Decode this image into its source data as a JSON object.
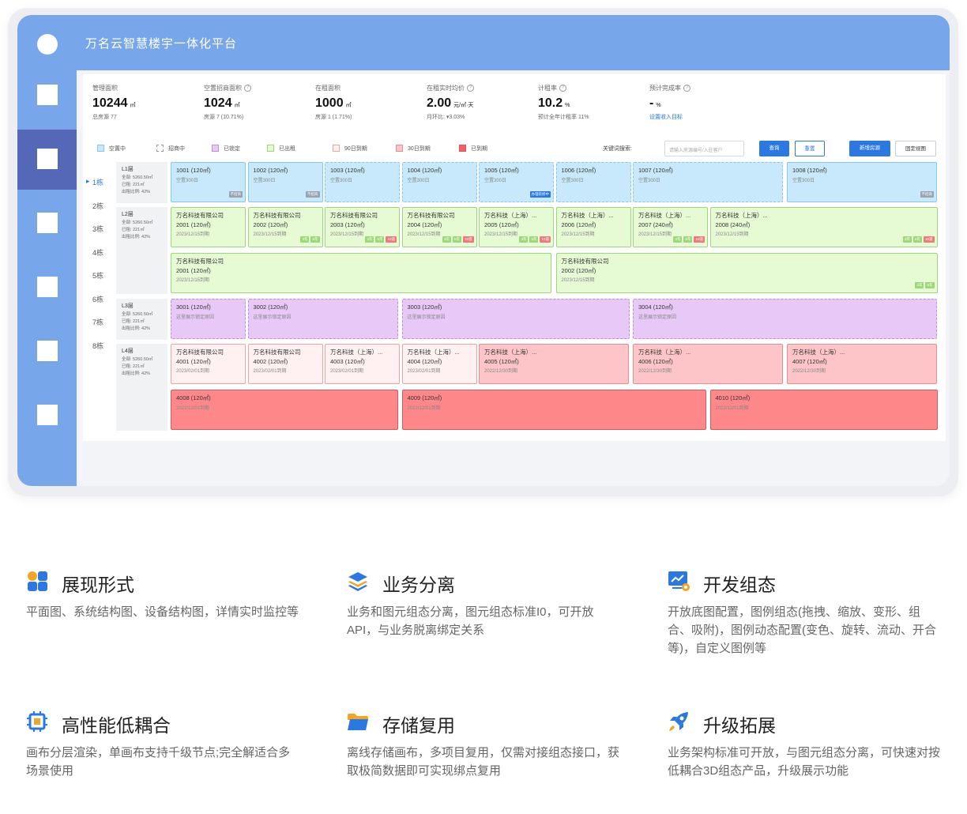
{
  "app": {
    "title": "万名云智慧楼宇一体化平台"
  },
  "colors": {
    "accent": "#78a6ea",
    "sidebar_active": "#5568b8",
    "primary_button": "#2a78e0"
  },
  "sidebar": {
    "items": 6,
    "active_index": 1
  },
  "stats": [
    {
      "label": "管理面积",
      "value": "10244",
      "unit": "㎡",
      "sub": "总房源 77",
      "info": false
    },
    {
      "label": "空置招商面积",
      "value": "1024",
      "unit": "㎡",
      "sub": "房源 7 (10.71%)",
      "info": true
    },
    {
      "label": "在租面积",
      "value": "1000",
      "unit": "㎡",
      "sub": "房源 1 (1.71%)",
      "info": false
    },
    {
      "label": "在租实时均价",
      "value": "2.00",
      "unit": "元/㎡·天",
      "sub": "月环比: ▾3.03%",
      "info": true
    },
    {
      "label": "计租率",
      "value": "10.2",
      "unit": "%",
      "sub": "预计全年计租率 11%",
      "info": true
    },
    {
      "label": "预计完成率",
      "value": "-",
      "unit": "%",
      "sub": "设置收入目标",
      "info": true
    }
  ],
  "legend": [
    {
      "label": "空置中",
      "color": "#c7e9fb",
      "border": "#83c9ed",
      "dashed": false
    },
    {
      "label": "招商中",
      "color": "#ffffff",
      "border": "#999999",
      "dashed": true
    },
    {
      "label": "已锁定",
      "color": "#e8c8f6",
      "border": "#bb92d8",
      "dashed": false
    },
    {
      "label": "已出租",
      "color": "#e6fad4",
      "border": "#9bd877",
      "dashed": false
    },
    {
      "label": "90日到期",
      "color": "#fff1f1",
      "border": "#eba3a3",
      "dashed": false
    },
    {
      "label": "30日到期",
      "color": "#fdc5c8",
      "border": "#e48d92",
      "dashed": false
    },
    {
      "label": "已到期",
      "color": "#fe5c63",
      "border": "#d05b60",
      "dashed": false
    }
  ],
  "search": {
    "label": "关键词搜索:",
    "placeholder": "请输入房源编号/入驻客户"
  },
  "buttons": {
    "query": "查询",
    "reset": "重置",
    "add_room": "新增房源",
    "fixed_view": "固定视图"
  },
  "buildings": [
    "1栋",
    "2栋",
    "3栋",
    "4栋",
    "5栋",
    "6栋",
    "7栋",
    "8栋"
  ],
  "floors": [
    {
      "name": "L1层",
      "meta": [
        "全部: 5260.50㎡",
        "已租: 221㎡",
        "出租比例: 42%"
      ]
    },
    {
      "name": "L2层",
      "meta": [
        "全部: 5260.50㎡",
        "已租: 221㎡",
        "出租比例: 42%"
      ]
    },
    {
      "name": "L3层",
      "meta": [
        "全部: 5260.50㎡",
        "已租: 221㎡",
        "出租比例: 42%"
      ]
    },
    {
      "name": "L4层",
      "meta": [
        "全部: 5260.50㎡",
        "已租: 221㎡",
        "出租比例: 42%"
      ]
    }
  ],
  "rooms": [
    {
      "status": "vacant",
      "code": "1001 (120㎡)",
      "note": "空置300日",
      "tag": "不招商"
    },
    {
      "status": "vacant",
      "code": "1002 (120㎡)",
      "note": "空置300日",
      "tag": "不招商"
    },
    {
      "status": "hiring",
      "code": "1003 (120㎡)",
      "note": "空置300日"
    },
    {
      "status": "hiring",
      "code": "1004 (120㎡)",
      "note": "空置300日"
    },
    {
      "status": "hiring",
      "code": "1005 (120㎡)",
      "note": "空置300日",
      "tag": "办理装修中"
    },
    {
      "status": "hiring",
      "code": "1006 (120㎡)",
      "note": "空置300日"
    },
    {
      "status": "hiring",
      "code": "1007 (120㎡)",
      "note": "空置300日"
    },
    {
      "status": "vacant",
      "code": "1008 (120㎡)",
      "note": "空置300日",
      "tag": "不招商"
    },
    {
      "status": "rented",
      "company": "万名科技有限公司",
      "code": "2001 (120㎡)",
      "note": "2023/12/15到期"
    },
    {
      "status": "rented",
      "company": "万名科技有限公司",
      "code": "2002 (120㎡)",
      "note": "2023/12/15到期",
      "tags": [
        "3年",
        "5年"
      ]
    },
    {
      "status": "rented",
      "company": "万名科技有限公司",
      "code": "2003 (120㎡)",
      "note": "2023/12/15到期",
      "tags": [
        "3年",
        "5年",
        "10道"
      ]
    },
    {
      "status": "rented",
      "company": "万名科技有限公司",
      "code": "2004 (120㎡)",
      "note": "2023/12/15到期",
      "tags": [
        "3年",
        "5年",
        "10道"
      ]
    },
    {
      "status": "rented",
      "company": "万名科技（上海）...",
      "code": "2005 (120㎡)",
      "note": "2023/12/15到期",
      "tags": [
        "3年",
        "5年",
        "10道"
      ]
    },
    {
      "status": "rented",
      "company": "万名科技（上海）...",
      "code": "2006 (120㎡)",
      "note": "2023/12/15到期"
    },
    {
      "status": "rented",
      "company": "万名科技（上海）...",
      "code": "2007 (240㎡)",
      "note": "2023/12/15到期",
      "tags": [
        "3年",
        "5年",
        "10道"
      ]
    },
    {
      "status": "rented",
      "company": "万名科技（上海）...",
      "code": "2008 (240㎡)",
      "note": "2023/12/15到期",
      "tags": [
        "3年",
        "5年",
        "10道"
      ]
    },
    {
      "status": "rented",
      "company": "万名科技有限公司",
      "code": "2001 (120㎡)",
      "note": "2023/12/15到期"
    },
    {
      "status": "rented",
      "company": "万名科技有限公司",
      "code": "2002 (120㎡)",
      "note": "2023/12/15到期",
      "tags": [
        "3年",
        "5年"
      ]
    },
    {
      "status": "locked",
      "code": "3001 (120㎡)",
      "note": "这里展示锁定原因"
    },
    {
      "status": "locked",
      "code": "3002 (120㎡)",
      "note": "这里展示锁定原因"
    },
    {
      "status": "locked",
      "code": "3003 (120㎡)",
      "note": "这里展示锁定原因"
    },
    {
      "status": "locked",
      "code": "3004 (120㎡)",
      "note": "这里展示锁定原因"
    },
    {
      "status": "d90",
      "company": "万名科技有限公司",
      "code": "4001 (120㎡)",
      "note": "2023/02/01到期"
    },
    {
      "status": "d90",
      "company": "万名科技有限公司",
      "code": "4002 (120㎡)",
      "note": "2023/02/01到期"
    },
    {
      "status": "d90",
      "company": "万名科技（上海）...",
      "code": "4003 (120㎡)",
      "note": "2023/02/01到期"
    },
    {
      "status": "d90",
      "company": "万名科技（上海）...",
      "code": "4004 (120㎡)",
      "note": "2023/02/01到期"
    },
    {
      "status": "d30",
      "company": "万名科技（上海）...",
      "code": "4005 (120㎡)",
      "note": "2022/12/30到期"
    },
    {
      "status": "d30",
      "company": "万名科技（上海）...",
      "code": "4006 (120㎡)",
      "note": "2022/12/30到期"
    },
    {
      "status": "d30",
      "company": "万名科技（上海）...",
      "code": "4007 (120㎡)",
      "note": "2022/12/30到期"
    },
    {
      "status": "exp",
      "code": "4008 (120㎡)",
      "note": "2022/12/01到期"
    },
    {
      "status": "exp",
      "code": "4009 (120㎡)",
      "note": "2022/12/01到期"
    },
    {
      "status": "exp",
      "code": "4010 (120㎡)",
      "note": "2022/12/01到期"
    }
  ],
  "features": [
    {
      "icon": "grid-icon",
      "title": "展现形式",
      "desc": "平面图、系统结构图、设备结构图，详情实时监控等"
    },
    {
      "icon": "layers-icon",
      "title": "业务分离",
      "desc": "业务和图元组态分离，图元组态标准I0，可开放API，与业务脱离绑定关系"
    },
    {
      "icon": "monitor-chart-icon",
      "title": "开发组态",
      "desc": "开放底图配置，图例组态(拖拽、缩放、变形、组合、吸附)，图例动态配置(变色、旋转、流动、开合等)，自定义图例等"
    },
    {
      "icon": "chip-icon",
      "title": "高性能低耦合",
      "desc": "画布分层渲染，单画布支持千级节点;完全解适合多场景使用"
    },
    {
      "icon": "folder-icon",
      "title": "存储复用",
      "desc": "离线存储画布，多项目复用，仅需对接组态接口，获取极简数据即可实现绑点复用"
    },
    {
      "icon": "rocket-icon",
      "title": "升级拓展",
      "desc": "业务架构标准可开放，与图元组态分离，可快速对按低耦合3D组态产品，升级展示功能"
    }
  ]
}
